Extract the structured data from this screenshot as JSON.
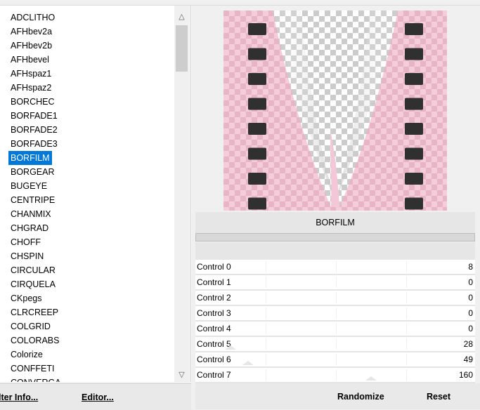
{
  "filters": {
    "items": [
      "ADCLITHO",
      "AFHbev2a",
      "AFHbev2b",
      "AFHbevel",
      "AFHspaz1",
      "AFHspaz2",
      "BORCHEC",
      "BORFADE1",
      "BORFADE2",
      "BORFADE3",
      "BORFILM",
      "BORGEAR",
      "BUGEYE",
      "CENTRIPE",
      "CHANMIX",
      "CHGRAD",
      "CHOFF",
      "CHSPIN",
      "CIRCULAR",
      "CIRQUELA",
      "CKpegs",
      "CLRCREEP",
      "COLGRID",
      "COLORABS",
      "Colorize",
      "CONFFETI",
      "CONVERGA"
    ],
    "selected": "BORFILM"
  },
  "scrollbar": {
    "up_icon": "chevron-up-icon",
    "down_icon": "chevron-down-icon"
  },
  "buttons": {
    "filter_info": "lter Info...",
    "editor": "Editor...",
    "randomize": "Randomize",
    "reset": "Reset"
  },
  "filter_name": "BORFILM",
  "controls": [
    {
      "label": "Control 0",
      "value": "8"
    },
    {
      "label": "Control 1",
      "value": "0"
    },
    {
      "label": "Control 2",
      "value": "0"
    },
    {
      "label": "Control 3",
      "value": "0"
    },
    {
      "label": "Control 4",
      "value": "0"
    },
    {
      "label": "Control 5",
      "value": "28"
    },
    {
      "label": "Control 6",
      "value": "49"
    },
    {
      "label": "Control 7",
      "value": "160"
    }
  ],
  "colors": {
    "selection": "#0078d7",
    "preview_pink": "#f2c6d6",
    "film_hole": "#303030"
  }
}
